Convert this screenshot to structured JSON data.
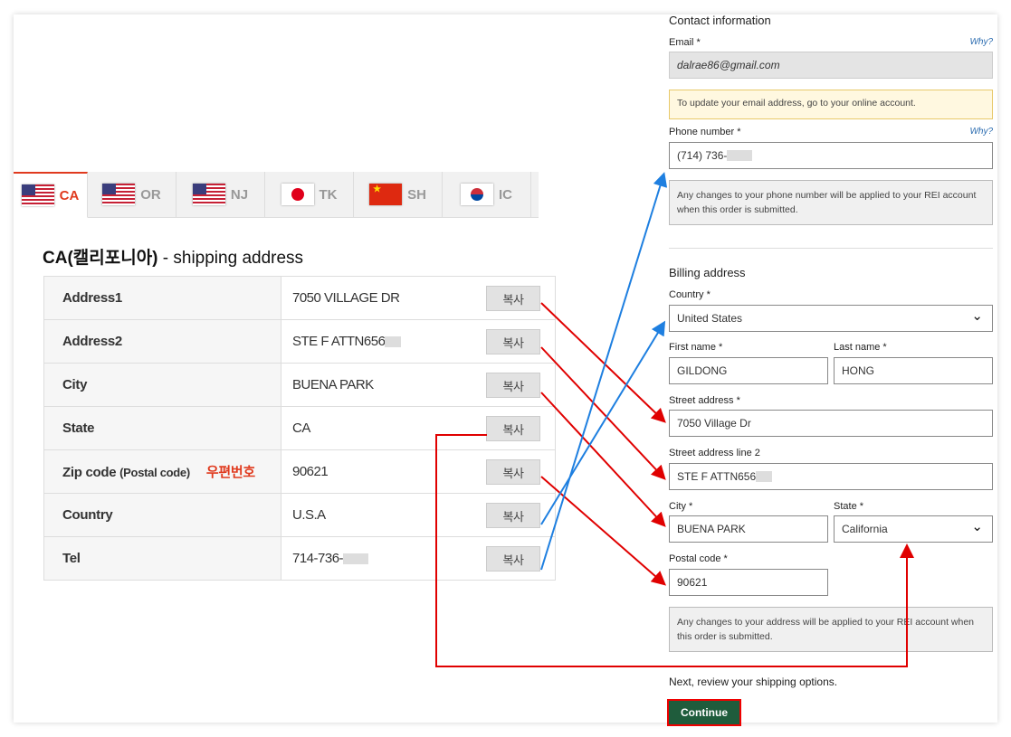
{
  "tabs": [
    {
      "code": "CA",
      "flag": "us"
    },
    {
      "code": "OR",
      "flag": "us"
    },
    {
      "code": "NJ",
      "flag": "us"
    },
    {
      "code": "TK",
      "flag": "jp"
    },
    {
      "code": "SH",
      "flag": "cn"
    },
    {
      "code": "IC",
      "flag": "kr"
    }
  ],
  "shipping": {
    "title_bold": "CA(캘리포니아)",
    "title_rest": " - shipping address",
    "copy_label": "복사",
    "rows": [
      {
        "key": "Address1",
        "value": "7050 VILLAGE DR"
      },
      {
        "key": "Address2",
        "value": "STE F ATTN656"
      },
      {
        "key": "City",
        "value": "BUENA PARK"
      },
      {
        "key": "State",
        "value": "CA"
      },
      {
        "key": "Zip code",
        "key_sub": "(Postal code)",
        "key_red": "우편번호",
        "value": "90621"
      },
      {
        "key": "Country",
        "value": "U.S.A"
      },
      {
        "key": "Tel",
        "value": "714-736-"
      }
    ]
  },
  "form": {
    "contact_heading": "Contact information",
    "email_label": "Email *",
    "why": "Why?",
    "email_value": "dalrae86@gmail.com",
    "email_note": "To update your email address, go to your online account.",
    "phone_label": "Phone number *",
    "phone_value": "(714) 736-",
    "phone_note": "Any changes to your phone number will be applied to your REI account when this order is submitted.",
    "billing_heading": "Billing address",
    "country_label": "Country *",
    "country_value": "United States",
    "first_label": "First name *",
    "first_value": "GILDONG",
    "last_label": "Last name *",
    "last_value": "HONG",
    "street_label": "Street address *",
    "street_value": "7050 Village Dr",
    "street2_label": "Street address line 2",
    "street2_value": "STE F ATTN656",
    "city_label": "City *",
    "city_value": "BUENA PARK",
    "state_label": "State *",
    "state_value": "California",
    "postal_label": "Postal code *",
    "postal_value": "90621",
    "address_note": "Any changes to your address will be applied to your REI account when this order is submitted.",
    "next_text": "Next, review your shipping options.",
    "continue_label": "Continue"
  },
  "colors": {
    "accent": "#e03a1e",
    "arrow_red": "#e00000",
    "arrow_blue": "#1e7fe0",
    "continue_bg": "#1f5c3c"
  }
}
